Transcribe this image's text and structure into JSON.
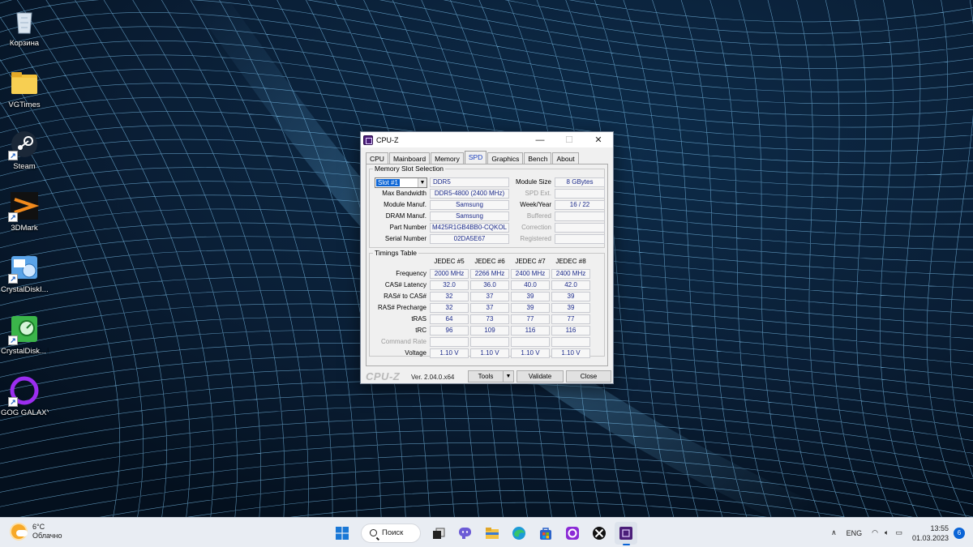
{
  "desktop": {
    "icons": [
      {
        "label": "Корзина",
        "icon": "recycle-bin-icon"
      },
      {
        "label": "VGTimes",
        "icon": "folder-icon"
      },
      {
        "label": "Steam",
        "icon": "steam-icon"
      },
      {
        "label": "3DMark",
        "icon": "3dmark-icon"
      },
      {
        "label": "CrystalDiskI...",
        "icon": "crystaldiskinfo-icon"
      },
      {
        "label": "CrystalDisk... 8",
        "icon": "crystaldiskmark-icon"
      },
      {
        "label": "GOG GALAXY",
        "icon": "gog-galaxy-icon"
      }
    ]
  },
  "window": {
    "title": "CPU-Z",
    "controls": {
      "minimize": "—",
      "maximize": "☐",
      "close": "✕"
    },
    "tabs": [
      "CPU",
      "Mainboard",
      "Memory",
      "SPD",
      "Graphics",
      "Bench",
      "About"
    ],
    "active_tab": "SPD",
    "slot_group": {
      "legend": "Memory Slot Selection",
      "slot": "Slot #1",
      "type": "DDR5",
      "left_rows": [
        {
          "label": "Max Bandwidth",
          "value": "DDR5-4800 (2400 MHz)"
        },
        {
          "label": "Module Manuf.",
          "value": "Samsung"
        },
        {
          "label": "DRAM Manuf.",
          "value": "Samsung"
        },
        {
          "label": "Part Number",
          "value": "M425R1GB4BB0-CQKOL"
        },
        {
          "label": "Serial Number",
          "value": "02DA5E67"
        }
      ],
      "right_rows": [
        {
          "label": "Module Size",
          "value": "8 GBytes",
          "enabled": true
        },
        {
          "label": "SPD Ext.",
          "value": "",
          "enabled": false
        },
        {
          "label": "Week/Year",
          "value": "16 / 22",
          "enabled": true
        },
        {
          "label": "Buffered",
          "value": "",
          "enabled": false
        },
        {
          "label": "Correction",
          "value": "",
          "enabled": false
        },
        {
          "label": "Registered",
          "value": "",
          "enabled": false
        }
      ]
    },
    "timings": {
      "legend": "Timings Table",
      "columns": [
        "JEDEC #5",
        "JEDEC #6",
        "JEDEC #7",
        "JEDEC #8"
      ],
      "rows": [
        {
          "label": "Frequency",
          "values": [
            "2000 MHz",
            "2266 MHz",
            "2400 MHz",
            "2400 MHz"
          ],
          "enabled": true
        },
        {
          "label": "CAS# Latency",
          "values": [
            "32.0",
            "36.0",
            "40.0",
            "42.0"
          ],
          "enabled": true
        },
        {
          "label": "RAS# to CAS#",
          "values": [
            "32",
            "37",
            "39",
            "39"
          ],
          "enabled": true
        },
        {
          "label": "RAS# Precharge",
          "values": [
            "32",
            "37",
            "39",
            "39"
          ],
          "enabled": true
        },
        {
          "label": "tRAS",
          "values": [
            "64",
            "73",
            "77",
            "77"
          ],
          "enabled": true
        },
        {
          "label": "tRC",
          "values": [
            "96",
            "109",
            "116",
            "116"
          ],
          "enabled": true
        },
        {
          "label": "Command Rate",
          "values": [
            "",
            "",
            "",
            ""
          ],
          "enabled": false
        },
        {
          "label": "Voltage",
          "values": [
            "1.10 V",
            "1.10 V",
            "1.10 V",
            "1.10 V"
          ],
          "enabled": true
        }
      ]
    },
    "footer": {
      "logo": "CPU-Z",
      "version": "Ver. 2.04.0.x64",
      "tools": "Tools",
      "validate": "Validate",
      "close": "Close"
    }
  },
  "taskbar": {
    "weather_temp": "6°C",
    "weather_desc": "Облачно",
    "search_label": "Поиск",
    "apps": [
      "start-icon",
      "task-view-icon",
      "chat-icon",
      "file-explorer-icon",
      "edge-icon",
      "store-icon",
      "gog-galaxy-icon",
      "xbox-icon",
      "cpu-z-icon"
    ],
    "language": "ENG",
    "time": "13:55",
    "date": "01.03.2023",
    "notifications": "6"
  }
}
